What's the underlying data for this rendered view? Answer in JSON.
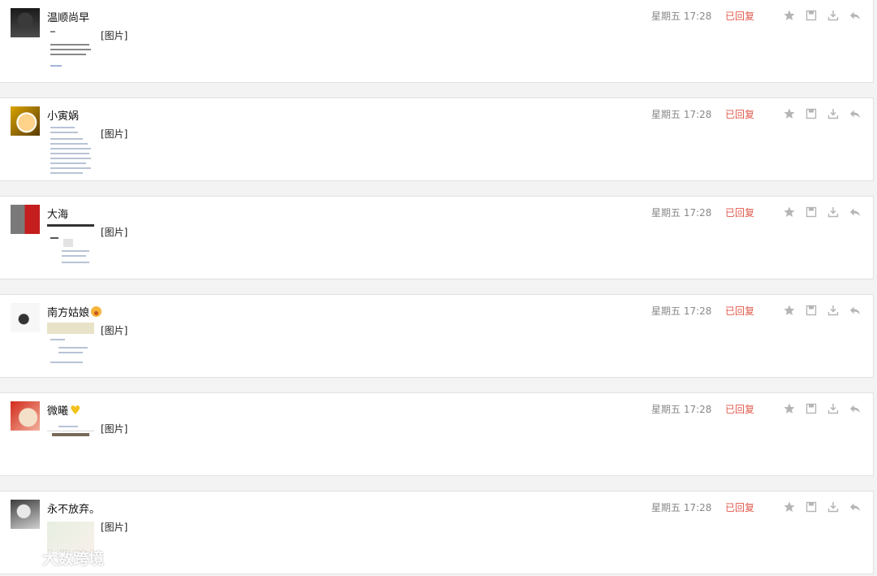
{
  "messages": [
    {
      "sender": "温顺尚早",
      "emoji": "",
      "attachment_label": "[图片]",
      "time": "星期五 17:28",
      "status": "已回复"
    },
    {
      "sender": "小寅娲",
      "emoji": "",
      "attachment_label": "[图片]",
      "time": "星期五 17:28",
      "status": "已回复"
    },
    {
      "sender": "大海",
      "emoji": "",
      "attachment_label": "[图片]",
      "time": "星期五 17:28",
      "status": "已回复"
    },
    {
      "sender": "南方姑娘",
      "emoji": "smile-emoji",
      "attachment_label": "[图片]",
      "time": "星期五 17:28",
      "status": "已回复"
    },
    {
      "sender": "微曦",
      "emoji": "yellow-heart-emoji",
      "attachment_label": "[图片]",
      "time": "星期五 17:28",
      "status": "已回复"
    },
    {
      "sender": "永不放弃。",
      "emoji": "",
      "attachment_label": "[图片]",
      "time": "星期五 17:28",
      "status": "已回复"
    }
  ],
  "actions": {
    "icons": [
      "star-icon",
      "save-icon",
      "download-icon",
      "reply-icon"
    ]
  },
  "watermark": {
    "text": "大数跨境",
    "logo": "logo-icon"
  },
  "colors": {
    "status_replied": "#e05a4d",
    "time": "#888888",
    "icon": "#b5b5b5",
    "card_bg": "#ffffff",
    "page_bg": "#f3f3f3"
  }
}
